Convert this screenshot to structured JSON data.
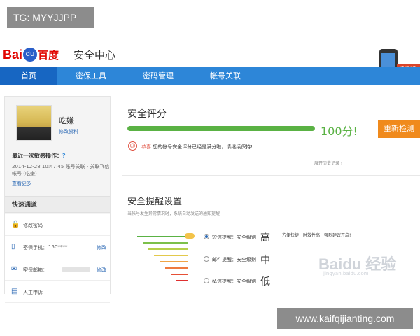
{
  "overlays": {
    "tag": "TG: MYYJJPP",
    "url": "www.kaifqijianting.com"
  },
  "header": {
    "logo_bai": "Bai",
    "logo_du": "du",
    "logo_cn": "百度",
    "title": "安全中心",
    "phone_badge": "手机版"
  },
  "nav": {
    "items": [
      {
        "label": "首页"
      },
      {
        "label": "密保工具"
      },
      {
        "label": "密码管理"
      },
      {
        "label": "帐号关联"
      }
    ]
  },
  "sidebar": {
    "username": "吃嫌",
    "edit_profile": "修改资料",
    "last_op_title": "最近一次敏感操作：",
    "last_op_help": "?",
    "last_op_detail": "2014-12-28 10:47:45  账号关联 - 关联飞信帐号 (吃嫌)",
    "see_more": "查看更多",
    "quick_title": "快速通道",
    "quick": [
      {
        "icon": "🔒",
        "label": "修改密码",
        "value": "",
        "edit": ""
      },
      {
        "icon": "▯",
        "label": "密保手机：",
        "value": "150****",
        "edit": "修改"
      },
      {
        "icon": "✉",
        "label": "密保邮箱：",
        "value": "",
        "edit": "修改"
      },
      {
        "icon": "▤",
        "label": "人工申诉",
        "value": "",
        "edit": ""
      }
    ]
  },
  "score": {
    "title": "安全评分",
    "value": "100分!",
    "percent": 100,
    "recheck": "重新检测",
    "congrats_pre": "恭喜",
    "congrats_text": "您的帐号安全评分已经是满分啦，请继续保持!",
    "history": "展开历史记录 ›"
  },
  "alerts": {
    "title": "安全提醒设置",
    "subtitle": "当帐号发生异常情况时，系统自动发送的通知提醒",
    "options": [
      {
        "label": "短信提醒：安全级别",
        "level": "高",
        "checked": true
      },
      {
        "label": "邮件提醒：安全级别",
        "level": "中",
        "checked": false
      },
      {
        "label": "私信提醒：安全级别",
        "level": "低",
        "checked": false
      }
    ],
    "tip": "方便快捷，时效性高，强烈建议开启!"
  },
  "watermark": {
    "main": "Baidu 经验",
    "sub": "jingyan.baidu.com"
  },
  "colors": {
    "nav": "#2d86d8",
    "nav_active": "#1766c2",
    "score_green": "#5ab244",
    "recheck_orange": "#f08a1c",
    "brand_red": "#e10602"
  }
}
